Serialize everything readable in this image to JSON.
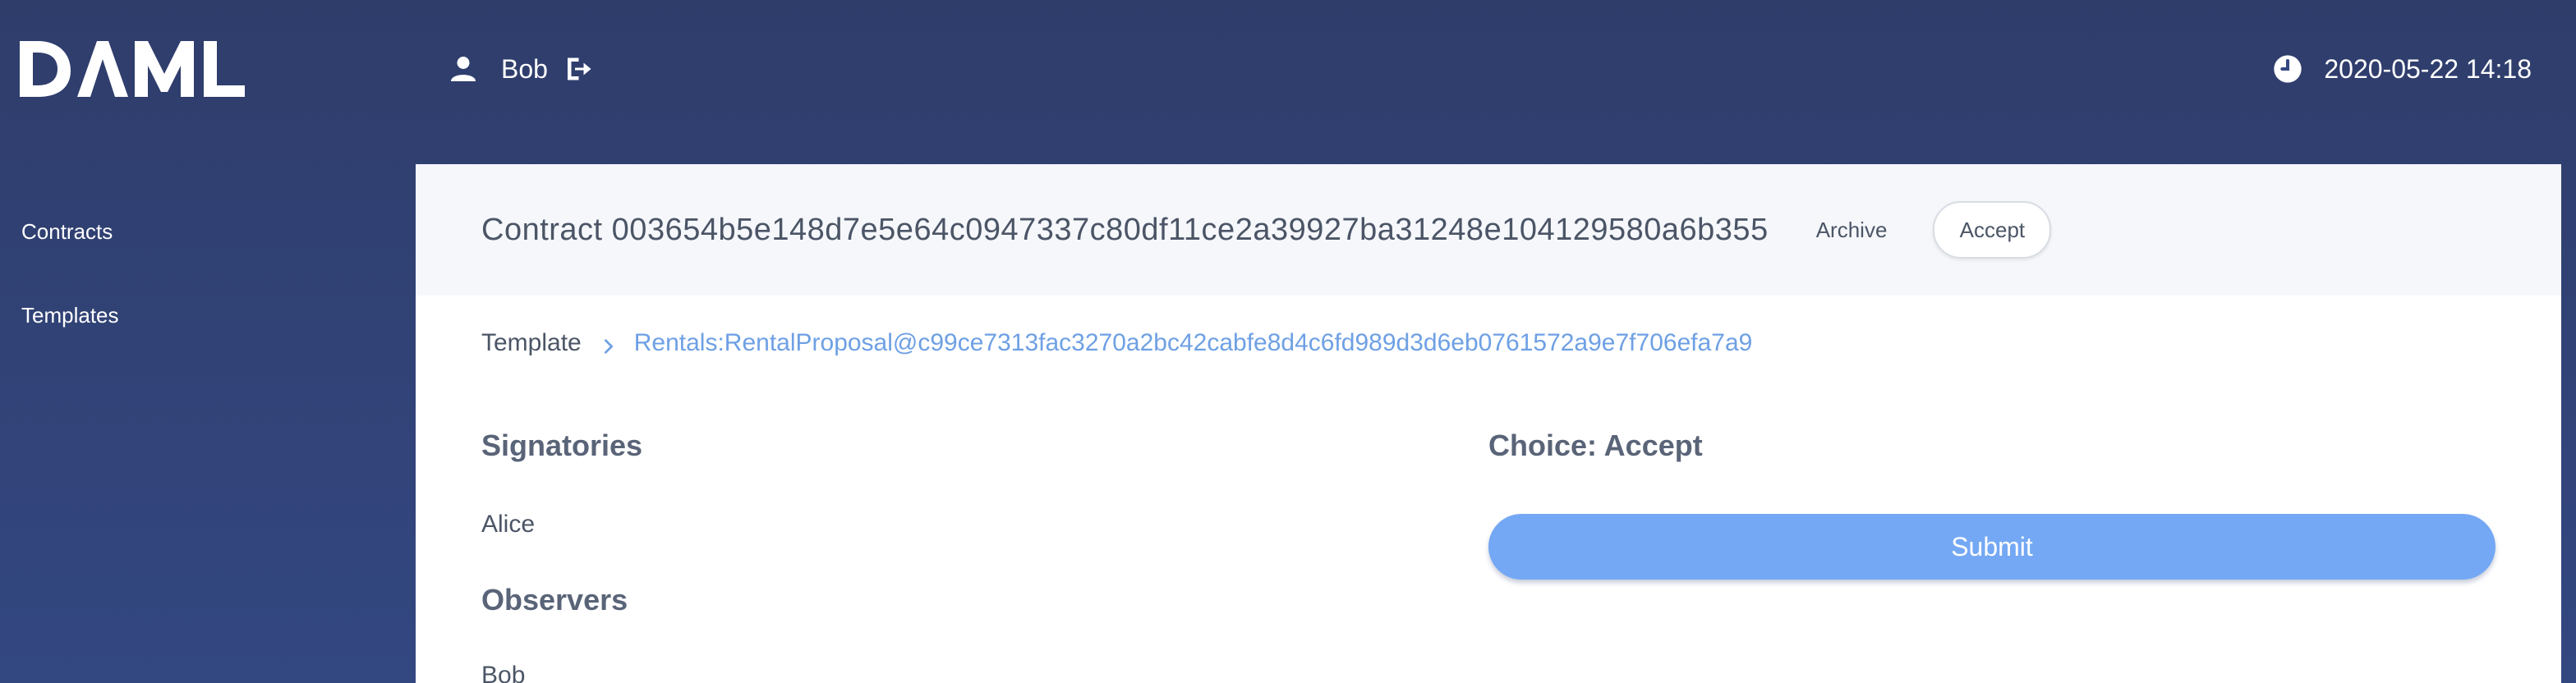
{
  "app": {
    "logo_text": "DAML"
  },
  "header": {
    "user_name": "Bob",
    "timestamp": "2020-05-22 14:18",
    "icons": {
      "user": "user-icon",
      "logout": "logout-icon",
      "clock": "clock-icon"
    }
  },
  "sidebar": {
    "items": [
      {
        "label": "Contracts"
      },
      {
        "label": "Templates"
      }
    ]
  },
  "contract": {
    "title": "Contract 003654b5e148d7e5e64c0947337c80df11ce2a39927ba31248e104129580a6b355",
    "archive_label": "Archive",
    "accept_label": "Accept",
    "breadcrumb_root": "Template",
    "template_link": "Rentals:RentalProposal@c99ce7313fac3270a2bc42cabfe8d4c6fd989d3d6eb0761572a9e7f706efa7a9"
  },
  "parties": {
    "signatories_heading": "Signatories",
    "signatories": [
      "Alice"
    ],
    "observers_heading": "Observers",
    "observers": [
      "Bob"
    ]
  },
  "choice": {
    "heading": "Choice: Accept",
    "submit_label": "Submit"
  },
  "colors": {
    "background": "#2f3d6b",
    "link": "#6ea0e4",
    "submit": "#74a8f4",
    "panel_header": "#f5f7fb"
  }
}
